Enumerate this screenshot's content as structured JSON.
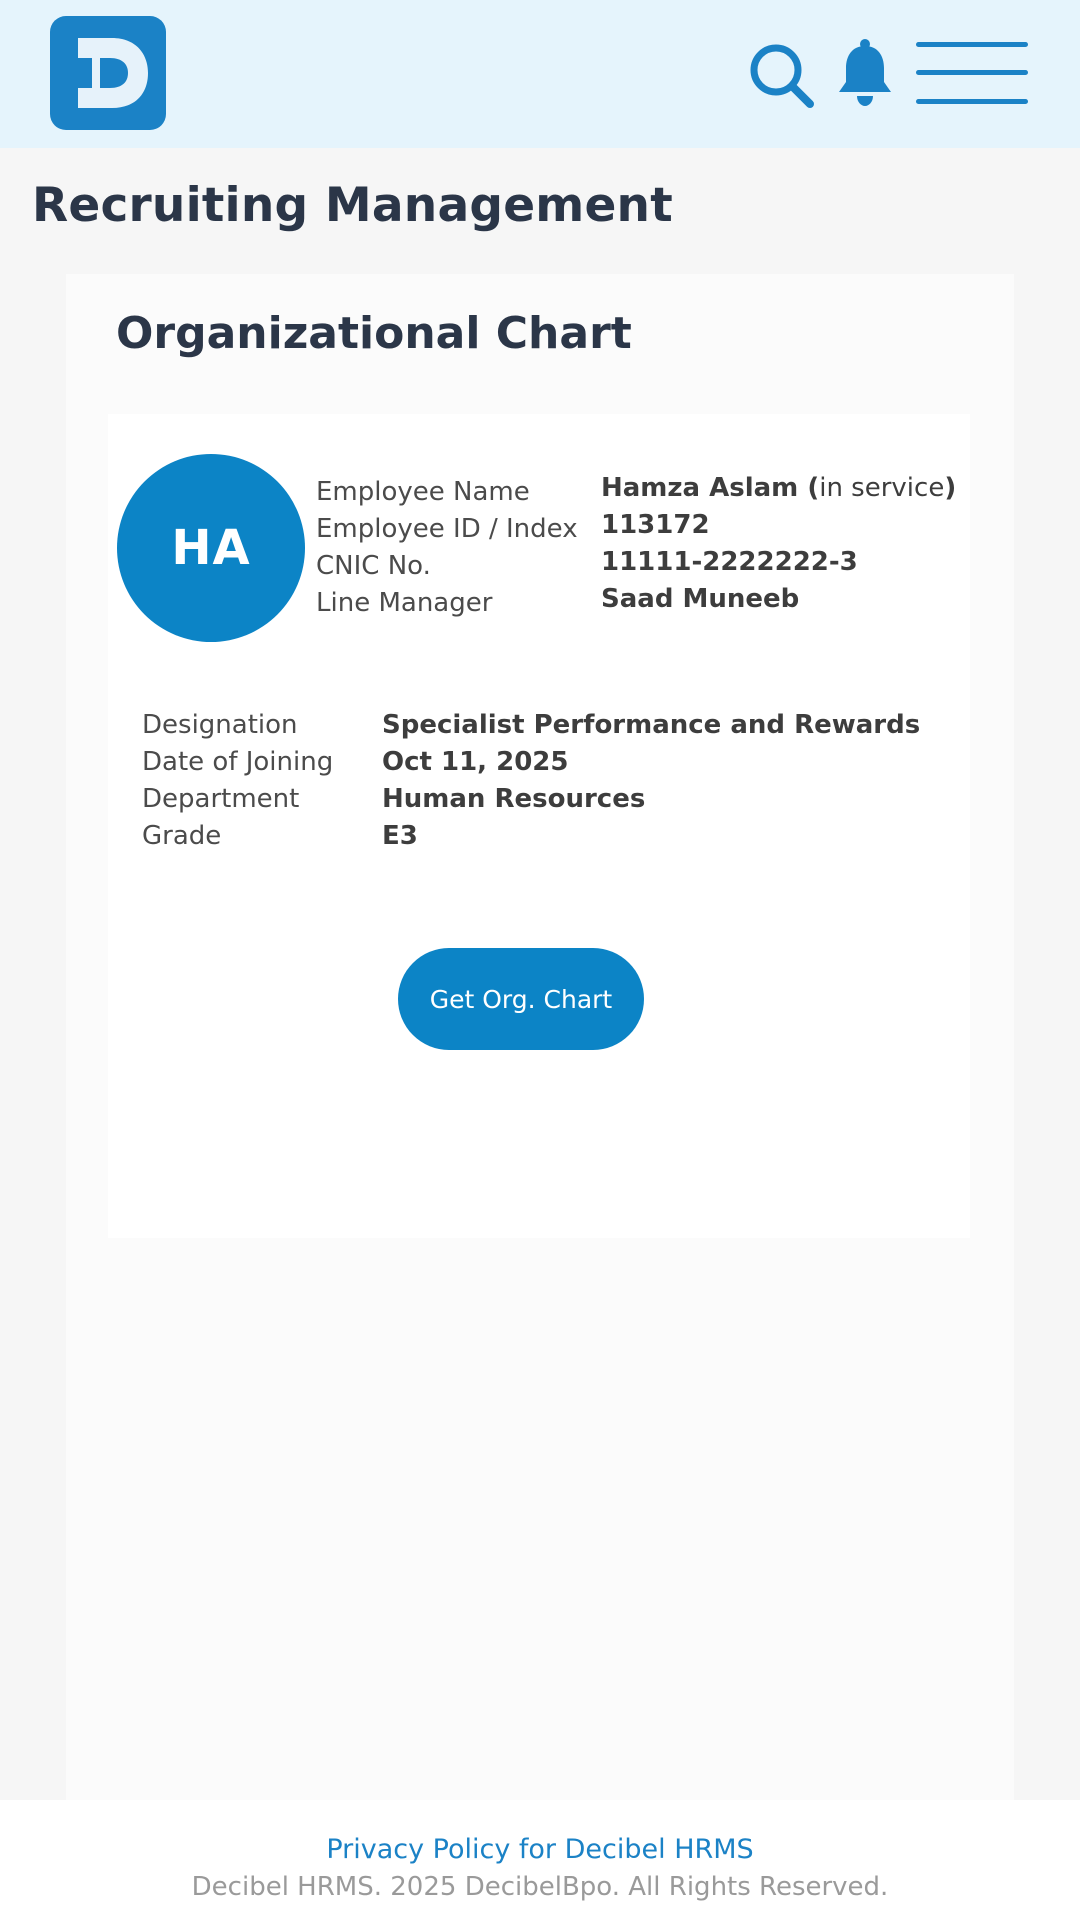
{
  "header": {
    "logo_icon": "decibel-d-logo",
    "search_icon": "search-icon",
    "notification_icon": "bell-icon",
    "menu_icon": "hamburger-menu-icon",
    "accent_color": "#1b82c6",
    "background_color": "#e5f4fc"
  },
  "page": {
    "title": "Recruiting Management"
  },
  "card": {
    "title": "Organizational Chart"
  },
  "employee": {
    "initials": "HA",
    "labels": {
      "name": "Employee Name",
      "id": "Employee ID / Index",
      "cnic": "CNIC No.",
      "line_manager": "Line Manager",
      "designation": "Designation",
      "joining": "Date of Joining",
      "department": "Department",
      "grade": "Grade"
    },
    "name": "Hamza Aslam",
    "status_open": " (",
    "status": "in service",
    "status_close": ")",
    "id": "113172",
    "cnic": "11111-2222222-3",
    "line_manager": "Saad Muneeb",
    "designation": "Specialist Performance and Rewards",
    "joining": "Oct 11, 2025",
    "department": "Human Resources",
    "grade": "E3"
  },
  "actions": {
    "org_chart_button": "Get Org. Chart",
    "button_color": "#0c84c6"
  },
  "footer": {
    "privacy_link": "Privacy Policy for Decibel HRMS",
    "copyright": "Decibel HRMS. 2025 DecibelBpo. All Rights Reserved."
  }
}
